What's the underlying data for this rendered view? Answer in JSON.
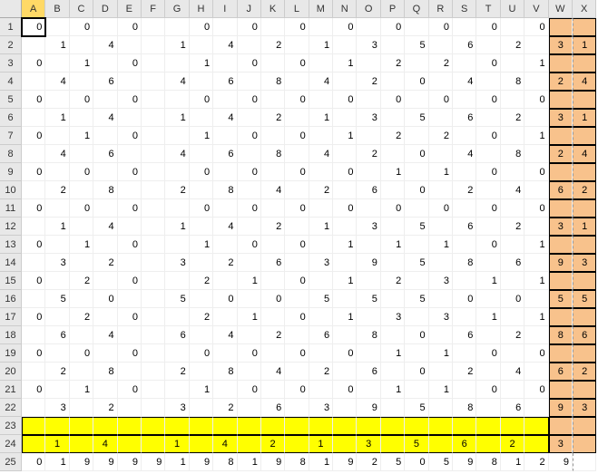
{
  "columns": [
    "A",
    "B",
    "C",
    "D",
    "E",
    "F",
    "G",
    "H",
    "I",
    "J",
    "K",
    "L",
    "M",
    "N",
    "O",
    "P",
    "Q",
    "R",
    "S",
    "T",
    "U",
    "V",
    "W",
    "X"
  ],
  "row_count": 25,
  "active_cell": {
    "row": 1,
    "col": 0
  },
  "orange_region": {
    "col_start": 22,
    "col_end": 23,
    "row_start": 1,
    "row_end": 24
  },
  "yellow_region": {
    "col_start": 0,
    "col_end": 21,
    "row_start": 23,
    "row_end": 24
  },
  "dashed_col": 23,
  "cells": {
    "1": {
      "A": "0",
      "C": "0",
      "E": "0",
      "H": "0",
      "J": "0",
      "L": "0",
      "N": "0",
      "P": "0",
      "R": "0",
      "T": "0",
      "V": "0"
    },
    "2": {
      "B": "1",
      "D": "4",
      "G": "1",
      "I": "4",
      "K": "2",
      "M": "1",
      "O": "3",
      "Q": "5",
      "S": "6",
      "U": "2",
      "W": "3",
      "X": "1"
    },
    "3": {
      "A": "0",
      "C": "1",
      "E": "0",
      "H": "1",
      "J": "0",
      "L": "0",
      "N": "1",
      "P": "2",
      "R": "2",
      "T": "0",
      "V": "1"
    },
    "4": {
      "B": "4",
      "D": "6",
      "G": "4",
      "I": "6",
      "K": "8",
      "M": "4",
      "O": "2",
      "Q": "0",
      "S": "4",
      "U": "8",
      "W": "2",
      "X": "4"
    },
    "5": {
      "A": "0",
      "C": "0",
      "E": "0",
      "H": "0",
      "J": "0",
      "L": "0",
      "N": "0",
      "P": "0",
      "R": "0",
      "T": "0",
      "V": "0"
    },
    "6": {
      "B": "1",
      "D": "4",
      "G": "1",
      "I": "4",
      "K": "2",
      "M": "1",
      "O": "3",
      "Q": "5",
      "S": "6",
      "U": "2",
      "W": "3",
      "X": "1"
    },
    "7": {
      "A": "0",
      "C": "1",
      "E": "0",
      "H": "1",
      "J": "0",
      "L": "0",
      "N": "1",
      "P": "2",
      "R": "2",
      "T": "0",
      "V": "1"
    },
    "8": {
      "B": "4",
      "D": "6",
      "G": "4",
      "I": "6",
      "K": "8",
      "M": "4",
      "O": "2",
      "Q": "0",
      "S": "4",
      "U": "8",
      "W": "2",
      "X": "4"
    },
    "9": {
      "A": "0",
      "C": "0",
      "E": "0",
      "H": "0",
      "J": "0",
      "L": "0",
      "N": "0",
      "P": "1",
      "R": "1",
      "T": "0",
      "V": "0"
    },
    "10": {
      "B": "2",
      "D": "8",
      "G": "2",
      "I": "8",
      "K": "4",
      "M": "2",
      "O": "6",
      "Q": "0",
      "S": "2",
      "U": "4",
      "W": "6",
      "X": "2"
    },
    "11": {
      "A": "0",
      "C": "0",
      "E": "0",
      "H": "0",
      "J": "0",
      "L": "0",
      "N": "0",
      "P": "0",
      "R": "0",
      "T": "0",
      "V": "0"
    },
    "12": {
      "B": "1",
      "D": "4",
      "G": "1",
      "I": "4",
      "K": "2",
      "M": "1",
      "O": "3",
      "Q": "5",
      "S": "6",
      "U": "2",
      "W": "3",
      "X": "1"
    },
    "13": {
      "A": "0",
      "C": "1",
      "E": "0",
      "H": "1",
      "J": "0",
      "L": "0",
      "N": "1",
      "P": "1",
      "R": "1",
      "T": "0",
      "V": "1"
    },
    "14": {
      "B": "3",
      "D": "2",
      "G": "3",
      "I": "2",
      "K": "6",
      "M": "3",
      "O": "9",
      "Q": "5",
      "S": "8",
      "U": "6",
      "W": "9",
      "X": "3"
    },
    "15": {
      "A": "0",
      "C": "2",
      "E": "0",
      "H": "2",
      "J": "1",
      "L": "0",
      "N": "1",
      "P": "2",
      "R": "3",
      "T": "1",
      "V": "1"
    },
    "16": {
      "B": "5",
      "D": "0",
      "G": "5",
      "I": "0",
      "K": "0",
      "M": "5",
      "O": "5",
      "Q": "5",
      "S": "0",
      "U": "0",
      "W": "5",
      "X": "5"
    },
    "17": {
      "A": "0",
      "C": "2",
      "E": "0",
      "H": "2",
      "J": "1",
      "L": "0",
      "N": "1",
      "P": "3",
      "R": "3",
      "T": "1",
      "V": "1"
    },
    "18": {
      "B": "6",
      "D": "4",
      "G": "6",
      "I": "4",
      "K": "2",
      "M": "6",
      "O": "8",
      "Q": "0",
      "S": "6",
      "U": "2",
      "W": "8",
      "X": "6"
    },
    "19": {
      "A": "0",
      "C": "0",
      "E": "0",
      "H": "0",
      "J": "0",
      "L": "0",
      "N": "0",
      "P": "1",
      "R": "1",
      "T": "0",
      "V": "0"
    },
    "20": {
      "B": "2",
      "D": "8",
      "G": "2",
      "I": "8",
      "K": "4",
      "M": "2",
      "O": "6",
      "Q": "0",
      "S": "2",
      "U": "4",
      "W": "6",
      "X": "2"
    },
    "21": {
      "A": "0",
      "C": "1",
      "E": "0",
      "H": "1",
      "J": "0",
      "L": "0",
      "N": "0",
      "P": "1",
      "R": "1",
      "T": "0",
      "V": "0"
    },
    "22": {
      "B": "3",
      "D": "2",
      "G": "3",
      "I": "2",
      "K": "6",
      "M": "3",
      "O": "9",
      "Q": "5",
      "S": "8",
      "U": "6",
      "W": "9",
      "X": "3"
    },
    "23": {},
    "24": {
      "B": "1",
      "D": "4",
      "G": "1",
      "I": "4",
      "K": "2",
      "M": "1",
      "O": "3",
      "Q": "5",
      "S": "6",
      "U": "2",
      "W": "3"
    },
    "25": {
      "A": "0",
      "B": "1",
      "C": "9",
      "D": "9",
      "E": "9",
      "F": "9",
      "G": "1",
      "H": "9",
      "I": "8",
      "J": "1",
      "K": "9",
      "L": "8",
      "M": "1",
      "N": "9",
      "O": "2",
      "P": "5",
      "Q": "0",
      "R": "5",
      "S": "9",
      "T": "8",
      "U": "1",
      "V": "2",
      "W": "9"
    }
  }
}
